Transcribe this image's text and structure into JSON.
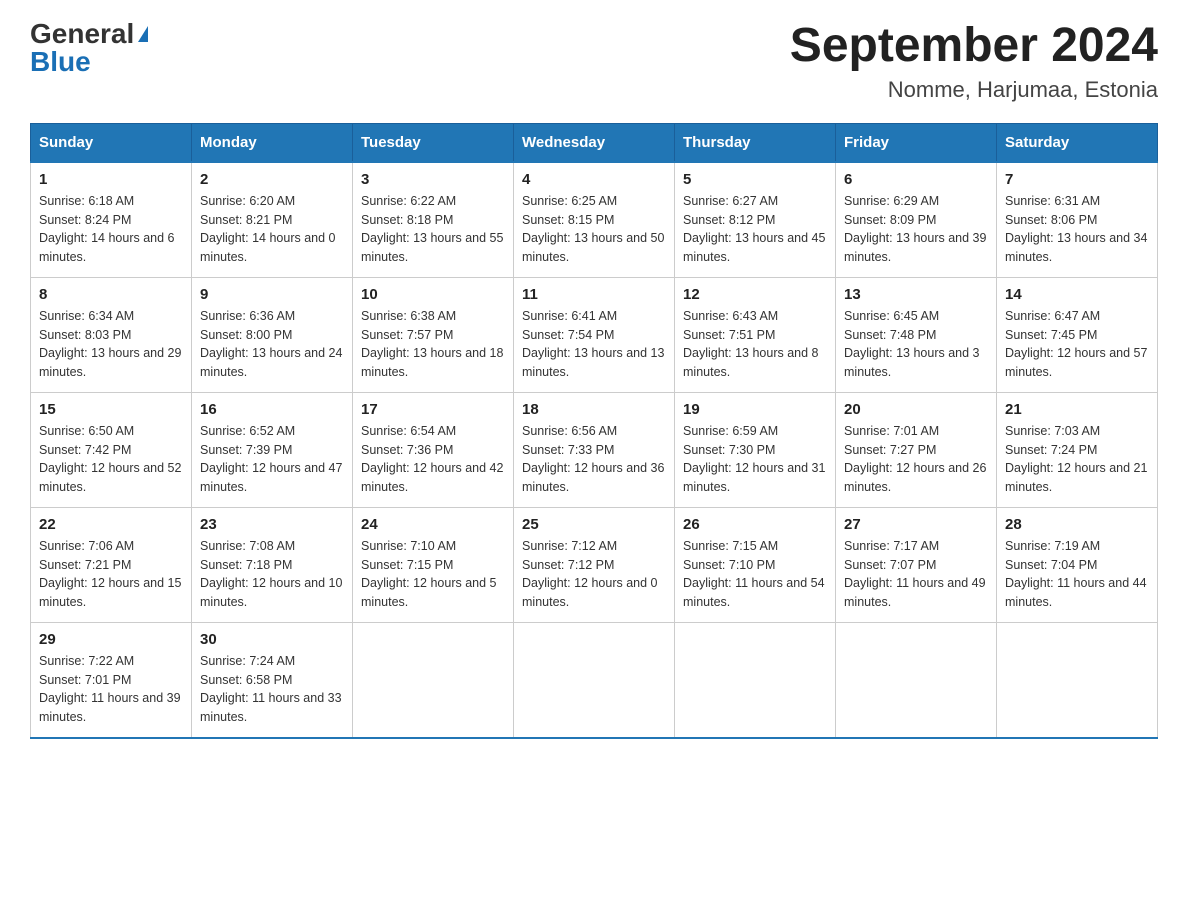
{
  "header": {
    "logo_general": "General",
    "logo_blue": "Blue",
    "title": "September 2024",
    "subtitle": "Nomme, Harjumaa, Estonia"
  },
  "weekdays": [
    "Sunday",
    "Monday",
    "Tuesday",
    "Wednesday",
    "Thursday",
    "Friday",
    "Saturday"
  ],
  "weeks": [
    [
      {
        "day": "1",
        "sunrise": "Sunrise: 6:18 AM",
        "sunset": "Sunset: 8:24 PM",
        "daylight": "Daylight: 14 hours and 6 minutes."
      },
      {
        "day": "2",
        "sunrise": "Sunrise: 6:20 AM",
        "sunset": "Sunset: 8:21 PM",
        "daylight": "Daylight: 14 hours and 0 minutes."
      },
      {
        "day": "3",
        "sunrise": "Sunrise: 6:22 AM",
        "sunset": "Sunset: 8:18 PM",
        "daylight": "Daylight: 13 hours and 55 minutes."
      },
      {
        "day": "4",
        "sunrise": "Sunrise: 6:25 AM",
        "sunset": "Sunset: 8:15 PM",
        "daylight": "Daylight: 13 hours and 50 minutes."
      },
      {
        "day": "5",
        "sunrise": "Sunrise: 6:27 AM",
        "sunset": "Sunset: 8:12 PM",
        "daylight": "Daylight: 13 hours and 45 minutes."
      },
      {
        "day": "6",
        "sunrise": "Sunrise: 6:29 AM",
        "sunset": "Sunset: 8:09 PM",
        "daylight": "Daylight: 13 hours and 39 minutes."
      },
      {
        "day": "7",
        "sunrise": "Sunrise: 6:31 AM",
        "sunset": "Sunset: 8:06 PM",
        "daylight": "Daylight: 13 hours and 34 minutes."
      }
    ],
    [
      {
        "day": "8",
        "sunrise": "Sunrise: 6:34 AM",
        "sunset": "Sunset: 8:03 PM",
        "daylight": "Daylight: 13 hours and 29 minutes."
      },
      {
        "day": "9",
        "sunrise": "Sunrise: 6:36 AM",
        "sunset": "Sunset: 8:00 PM",
        "daylight": "Daylight: 13 hours and 24 minutes."
      },
      {
        "day": "10",
        "sunrise": "Sunrise: 6:38 AM",
        "sunset": "Sunset: 7:57 PM",
        "daylight": "Daylight: 13 hours and 18 minutes."
      },
      {
        "day": "11",
        "sunrise": "Sunrise: 6:41 AM",
        "sunset": "Sunset: 7:54 PM",
        "daylight": "Daylight: 13 hours and 13 minutes."
      },
      {
        "day": "12",
        "sunrise": "Sunrise: 6:43 AM",
        "sunset": "Sunset: 7:51 PM",
        "daylight": "Daylight: 13 hours and 8 minutes."
      },
      {
        "day": "13",
        "sunrise": "Sunrise: 6:45 AM",
        "sunset": "Sunset: 7:48 PM",
        "daylight": "Daylight: 13 hours and 3 minutes."
      },
      {
        "day": "14",
        "sunrise": "Sunrise: 6:47 AM",
        "sunset": "Sunset: 7:45 PM",
        "daylight": "Daylight: 12 hours and 57 minutes."
      }
    ],
    [
      {
        "day": "15",
        "sunrise": "Sunrise: 6:50 AM",
        "sunset": "Sunset: 7:42 PM",
        "daylight": "Daylight: 12 hours and 52 minutes."
      },
      {
        "day": "16",
        "sunrise": "Sunrise: 6:52 AM",
        "sunset": "Sunset: 7:39 PM",
        "daylight": "Daylight: 12 hours and 47 minutes."
      },
      {
        "day": "17",
        "sunrise": "Sunrise: 6:54 AM",
        "sunset": "Sunset: 7:36 PM",
        "daylight": "Daylight: 12 hours and 42 minutes."
      },
      {
        "day": "18",
        "sunrise": "Sunrise: 6:56 AM",
        "sunset": "Sunset: 7:33 PM",
        "daylight": "Daylight: 12 hours and 36 minutes."
      },
      {
        "day": "19",
        "sunrise": "Sunrise: 6:59 AM",
        "sunset": "Sunset: 7:30 PM",
        "daylight": "Daylight: 12 hours and 31 minutes."
      },
      {
        "day": "20",
        "sunrise": "Sunrise: 7:01 AM",
        "sunset": "Sunset: 7:27 PM",
        "daylight": "Daylight: 12 hours and 26 minutes."
      },
      {
        "day": "21",
        "sunrise": "Sunrise: 7:03 AM",
        "sunset": "Sunset: 7:24 PM",
        "daylight": "Daylight: 12 hours and 21 minutes."
      }
    ],
    [
      {
        "day": "22",
        "sunrise": "Sunrise: 7:06 AM",
        "sunset": "Sunset: 7:21 PM",
        "daylight": "Daylight: 12 hours and 15 minutes."
      },
      {
        "day": "23",
        "sunrise": "Sunrise: 7:08 AM",
        "sunset": "Sunset: 7:18 PM",
        "daylight": "Daylight: 12 hours and 10 minutes."
      },
      {
        "day": "24",
        "sunrise": "Sunrise: 7:10 AM",
        "sunset": "Sunset: 7:15 PM",
        "daylight": "Daylight: 12 hours and 5 minutes."
      },
      {
        "day": "25",
        "sunrise": "Sunrise: 7:12 AM",
        "sunset": "Sunset: 7:12 PM",
        "daylight": "Daylight: 12 hours and 0 minutes."
      },
      {
        "day": "26",
        "sunrise": "Sunrise: 7:15 AM",
        "sunset": "Sunset: 7:10 PM",
        "daylight": "Daylight: 11 hours and 54 minutes."
      },
      {
        "day": "27",
        "sunrise": "Sunrise: 7:17 AM",
        "sunset": "Sunset: 7:07 PM",
        "daylight": "Daylight: 11 hours and 49 minutes."
      },
      {
        "day": "28",
        "sunrise": "Sunrise: 7:19 AM",
        "sunset": "Sunset: 7:04 PM",
        "daylight": "Daylight: 11 hours and 44 minutes."
      }
    ],
    [
      {
        "day": "29",
        "sunrise": "Sunrise: 7:22 AM",
        "sunset": "Sunset: 7:01 PM",
        "daylight": "Daylight: 11 hours and 39 minutes."
      },
      {
        "day": "30",
        "sunrise": "Sunrise: 7:24 AM",
        "sunset": "Sunset: 6:58 PM",
        "daylight": "Daylight: 11 hours and 33 minutes."
      },
      null,
      null,
      null,
      null,
      null
    ]
  ]
}
